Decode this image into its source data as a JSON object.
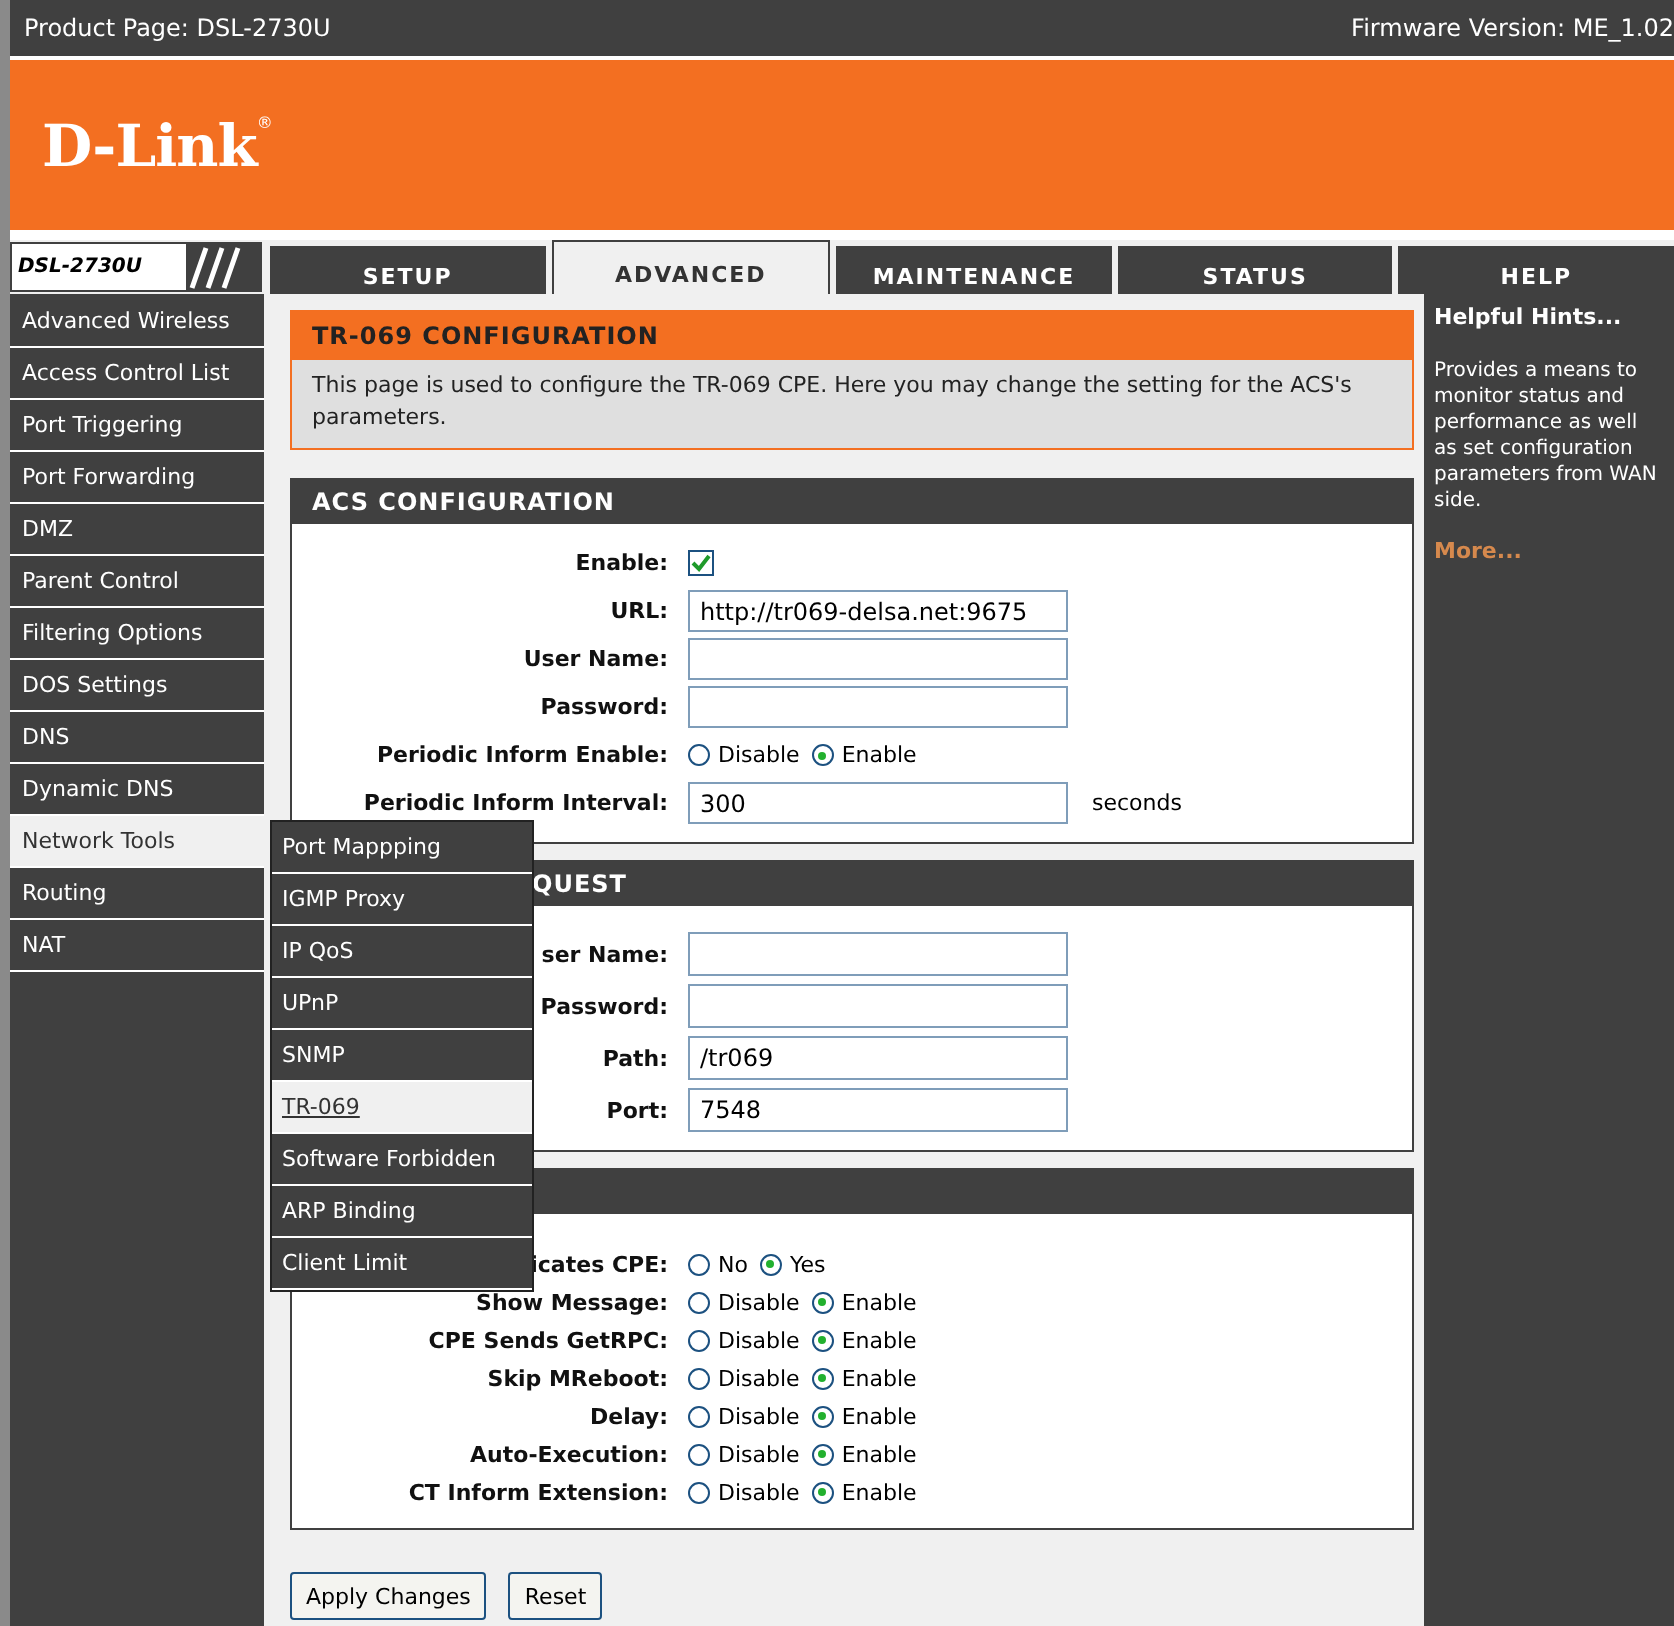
{
  "header": {
    "product": "Product Page: DSL-2730U",
    "firmware": "Firmware Version: ME_1.02"
  },
  "logo": {
    "text": "D-Link",
    "mark": "®"
  },
  "model_badge": "DSL-2730U",
  "tabs": [
    {
      "label": "SETUP",
      "selected": false
    },
    {
      "label": "ADVANCED",
      "selected": true
    },
    {
      "label": "MAINTENANCE",
      "selected": false
    },
    {
      "label": "STATUS",
      "selected": false
    },
    {
      "label": "HELP",
      "selected": false
    }
  ],
  "sidebar": {
    "items": [
      {
        "label": "Advanced Wireless",
        "selected": false
      },
      {
        "label": "Access Control List",
        "selected": false
      },
      {
        "label": "Port Triggering",
        "selected": false
      },
      {
        "label": "Port Forwarding",
        "selected": false
      },
      {
        "label": "DMZ",
        "selected": false
      },
      {
        "label": "Parent Control",
        "selected": false
      },
      {
        "label": "Filtering Options",
        "selected": false
      },
      {
        "label": "DOS Settings",
        "selected": false
      },
      {
        "label": "DNS",
        "selected": false
      },
      {
        "label": "Dynamic DNS",
        "selected": false
      },
      {
        "label": "Network Tools",
        "selected": true
      },
      {
        "label": "Routing",
        "selected": false
      },
      {
        "label": "NAT",
        "selected": false
      }
    ]
  },
  "submenu": {
    "items": [
      {
        "label": "Port Mappping",
        "selected": false
      },
      {
        "label": "IGMP Proxy",
        "selected": false
      },
      {
        "label": "IP QoS",
        "selected": false
      },
      {
        "label": "UPnP",
        "selected": false
      },
      {
        "label": "SNMP",
        "selected": false
      },
      {
        "label": "TR-069",
        "selected": true
      },
      {
        "label": "Software Forbidden",
        "selected": false
      },
      {
        "label": "ARP Binding",
        "selected": false
      },
      {
        "label": "Client Limit",
        "selected": false
      }
    ]
  },
  "intro": {
    "title": "TR-069 CONFIGURATION",
    "text": "This page is used to configure the TR-069 CPE. Here you may change the setting for the ACS's parameters."
  },
  "sections": [
    {
      "title": "ACS CONFIGURATION",
      "rows": [
        {
          "kind": "checkbox",
          "label": "Enable:",
          "checked": true
        },
        {
          "kind": "text",
          "label": "URL:",
          "value": "http://tr069-delsa.net:9675"
        },
        {
          "kind": "text",
          "label": "User Name:"
        },
        {
          "kind": "text",
          "label": "Password:"
        },
        {
          "kind": "radio",
          "label": "Periodic Inform Enable:",
          "options": [
            {
              "label": "Disable",
              "selected": false
            },
            {
              "label": "Enable",
              "selected": true
            }
          ]
        },
        {
          "kind": "text",
          "label": "Periodic Inform Interval:",
          "value": "300",
          "unit": "seconds"
        }
      ]
    },
    {
      "title": "QUEST",
      "rows": [
        {
          "kind": "text",
          "label": "ser Name:"
        },
        {
          "kind": "text",
          "label": "Password:"
        },
        {
          "kind": "text",
          "label": "Path:",
          "value": "/tr069"
        },
        {
          "kind": "text",
          "label": "Port:",
          "value": "7548"
        }
      ]
    },
    {
      "rows": [
        {
          "kind": "radio",
          "label": "icates CPE:",
          "options": [
            {
              "label": "No",
              "selected": false
            },
            {
              "label": "Yes",
              "selected": true
            }
          ]
        },
        {
          "kind": "radio",
          "label": "Show Message:",
          "options": [
            {
              "label": "Disable",
              "selected": false
            },
            {
              "label": "Enable",
              "selected": true
            }
          ]
        },
        {
          "kind": "radio",
          "label": "CPE Sends GetRPC:",
          "options": [
            {
              "label": "Disable",
              "selected": false
            },
            {
              "label": "Enable",
              "selected": true
            }
          ]
        },
        {
          "kind": "radio",
          "label": "Skip MReboot:",
          "options": [
            {
              "label": "Disable",
              "selected": false
            },
            {
              "label": "Enable",
              "selected": true
            }
          ]
        },
        {
          "kind": "radio",
          "label": "Delay:",
          "options": [
            {
              "label": "Disable",
              "selected": false
            },
            {
              "label": "Enable",
              "selected": true
            }
          ]
        },
        {
          "kind": "radio",
          "label": "Auto-Execution:",
          "options": [
            {
              "label": "Disable",
              "selected": false
            },
            {
              "label": "Enable",
              "selected": true
            }
          ]
        },
        {
          "kind": "radio",
          "label": "CT Inform Extension:",
          "options": [
            {
              "label": "Disable",
              "selected": false
            },
            {
              "label": "Enable",
              "selected": true
            }
          ]
        }
      ]
    }
  ],
  "buttons": [
    "Apply Changes",
    "Reset"
  ],
  "hints": {
    "title": "Helpful Hints...",
    "text": "Provides a means to monitor status and performance as well as set configuration parameters from WAN side.",
    "more": "More..."
  }
}
